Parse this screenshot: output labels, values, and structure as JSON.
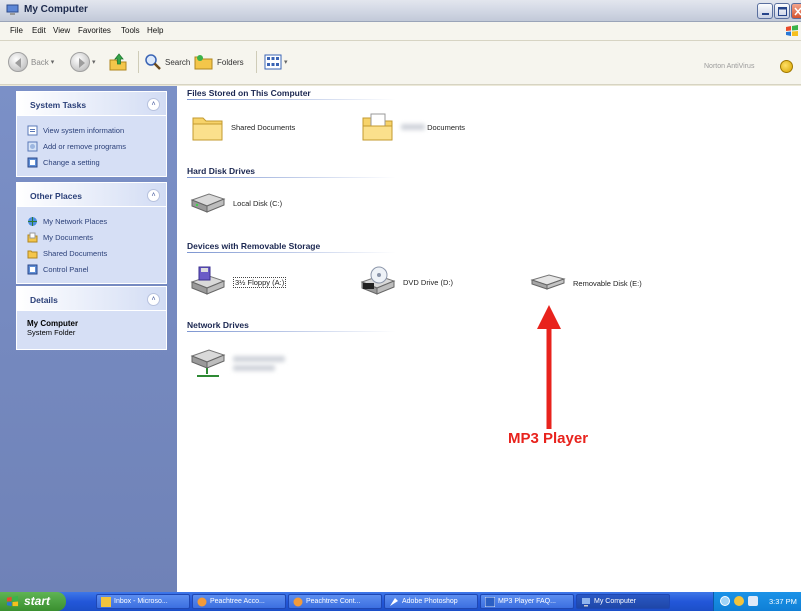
{
  "window": {
    "title": "My Computer",
    "menu": [
      "File",
      "Edit",
      "View",
      "Favorites",
      "Tools",
      "Help"
    ]
  },
  "toolbar": {
    "back_label": "Back",
    "search_label": "Search",
    "folders_label": "Folders",
    "norton_label": "Norton AntiVirus"
  },
  "taskpane": {
    "system_tasks": {
      "title": "System Tasks",
      "items": [
        "View system information",
        "Add or remove programs",
        "Change a setting"
      ]
    },
    "other_places": {
      "title": "Other Places",
      "items": [
        "My Network Places",
        "My Documents",
        "Shared Documents",
        "Control Panel"
      ]
    },
    "details": {
      "title": "Details",
      "name": "My Computer",
      "type": "System Folder"
    }
  },
  "content": {
    "groups": {
      "files": "Files Stored on This Computer",
      "hdd": "Hard Disk Drives",
      "removable": "Devices with Removable Storage",
      "network": "Network Drives"
    },
    "items": {
      "shared_docs": "Shared Documents",
      "user_docs": "Documents",
      "local_disk": "Local Disk (C:)",
      "floppy": "3½ Floppy (A:)",
      "dvd": "DVD Drive (D:)",
      "removable": "Removable Disk (E:)"
    },
    "annotation": "MP3 Player"
  },
  "taskbar": {
    "start_label": "start",
    "tasks": [
      "Inbox - Microso...",
      "Peachtree Acco...",
      "Peachtree Cont...",
      "Adobe Photoshop",
      "MP3 Player FAQ...",
      "My Computer"
    ],
    "clock": "3:37 PM"
  },
  "colors": {
    "accent_red": "#e8231d",
    "taskpane_blue": "#7b90c7",
    "taskbar_blue": "#2357d9"
  }
}
